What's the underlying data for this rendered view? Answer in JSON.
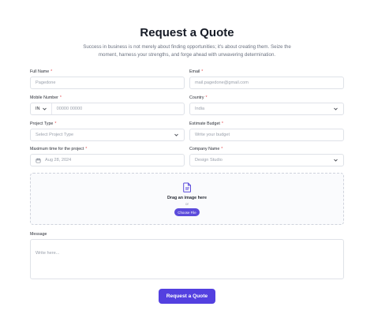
{
  "header": {
    "title": "Request a Quote",
    "subtitle": "Success in business is not merely about finding opportunities; it's about creating them. Seize the moment, harness your strengths, and forge ahead with unwavering determination."
  },
  "form": {
    "full_name": {
      "label": "Full Name",
      "placeholder": "Pagedone"
    },
    "email": {
      "label": "Email",
      "placeholder": "mail.pagedone@gmail.com"
    },
    "mobile": {
      "label": "Mobile Number",
      "country_code": "IN",
      "placeholder": "00000 00000"
    },
    "country": {
      "label": "Country",
      "value": "India"
    },
    "project_type": {
      "label": "Project Type",
      "value": "Select Project Type"
    },
    "budget": {
      "label": "Estimate Budget",
      "placeholder": "Write your budget"
    },
    "max_time": {
      "label": "Maximum time for the project",
      "value": "Aug 28, 2024"
    },
    "company": {
      "label": "Company Name",
      "placeholder": "Design Studio"
    },
    "upload": {
      "text": "Drag an image here",
      "or": "or",
      "button": "Choose File"
    },
    "message": {
      "label": "Message",
      "placeholder": "Write here..."
    },
    "required_marker": "*",
    "submit": "Request a Quote"
  },
  "colors": {
    "accent": "#5340e0",
    "required": "#e5484d",
    "border": "#dfe2e8"
  }
}
